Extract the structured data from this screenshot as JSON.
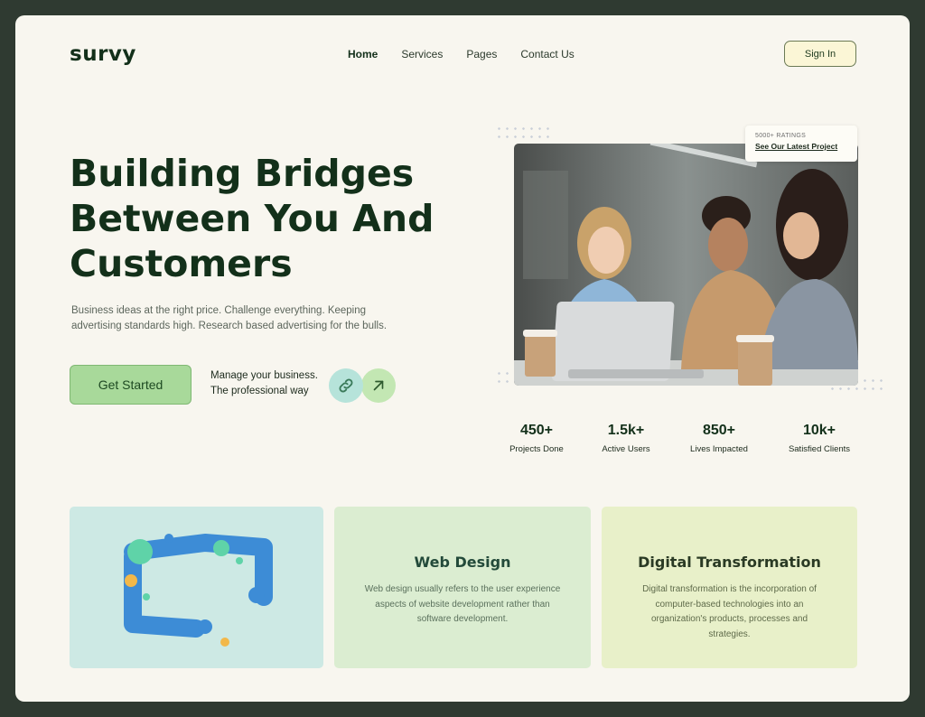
{
  "brand": {
    "logo": "survy"
  },
  "nav": {
    "items": [
      "Home",
      "Services",
      "Pages",
      "Contact Us"
    ],
    "active": "Home",
    "signin_label": "Sign In"
  },
  "hero": {
    "title_line1": "Building Bridges",
    "title_line2": "Between You And",
    "title_line3": "Customers",
    "subtitle": "Business ideas at the right price. Challenge everything. Keeping advertising standards high. Research based advertising for the bulls.",
    "cta_label": "Get Started",
    "manage_line1": "Manage your business.",
    "manage_line2": "The professional way",
    "icons": [
      "link-icon",
      "arrow-up-right-icon"
    ]
  },
  "ratings": {
    "small": "5000+ RATINGS",
    "link": "See Our Latest Project"
  },
  "stats": [
    {
      "num": "450+",
      "label": "Projects Done"
    },
    {
      "num": "1.5k+",
      "label": "Active Users"
    },
    {
      "num": "850+",
      "label": "Lives Impacted"
    },
    {
      "num": "10k+",
      "label": "Satisfied Clients"
    }
  ],
  "services": {
    "web_design": {
      "title": "Web Design",
      "desc": "Web design usually refers to the user experience aspects of website development rather than software development."
    },
    "digital": {
      "title": "Digital Transformation",
      "desc": "Digital transformation is the incorporation of computer-based technologies into an organization's products, processes and strategies."
    }
  },
  "colors": {
    "bg_dark": "#2f3a31",
    "card": "#f8f6ef",
    "cta_green": "#a8d99a",
    "headline": "#13301a"
  }
}
